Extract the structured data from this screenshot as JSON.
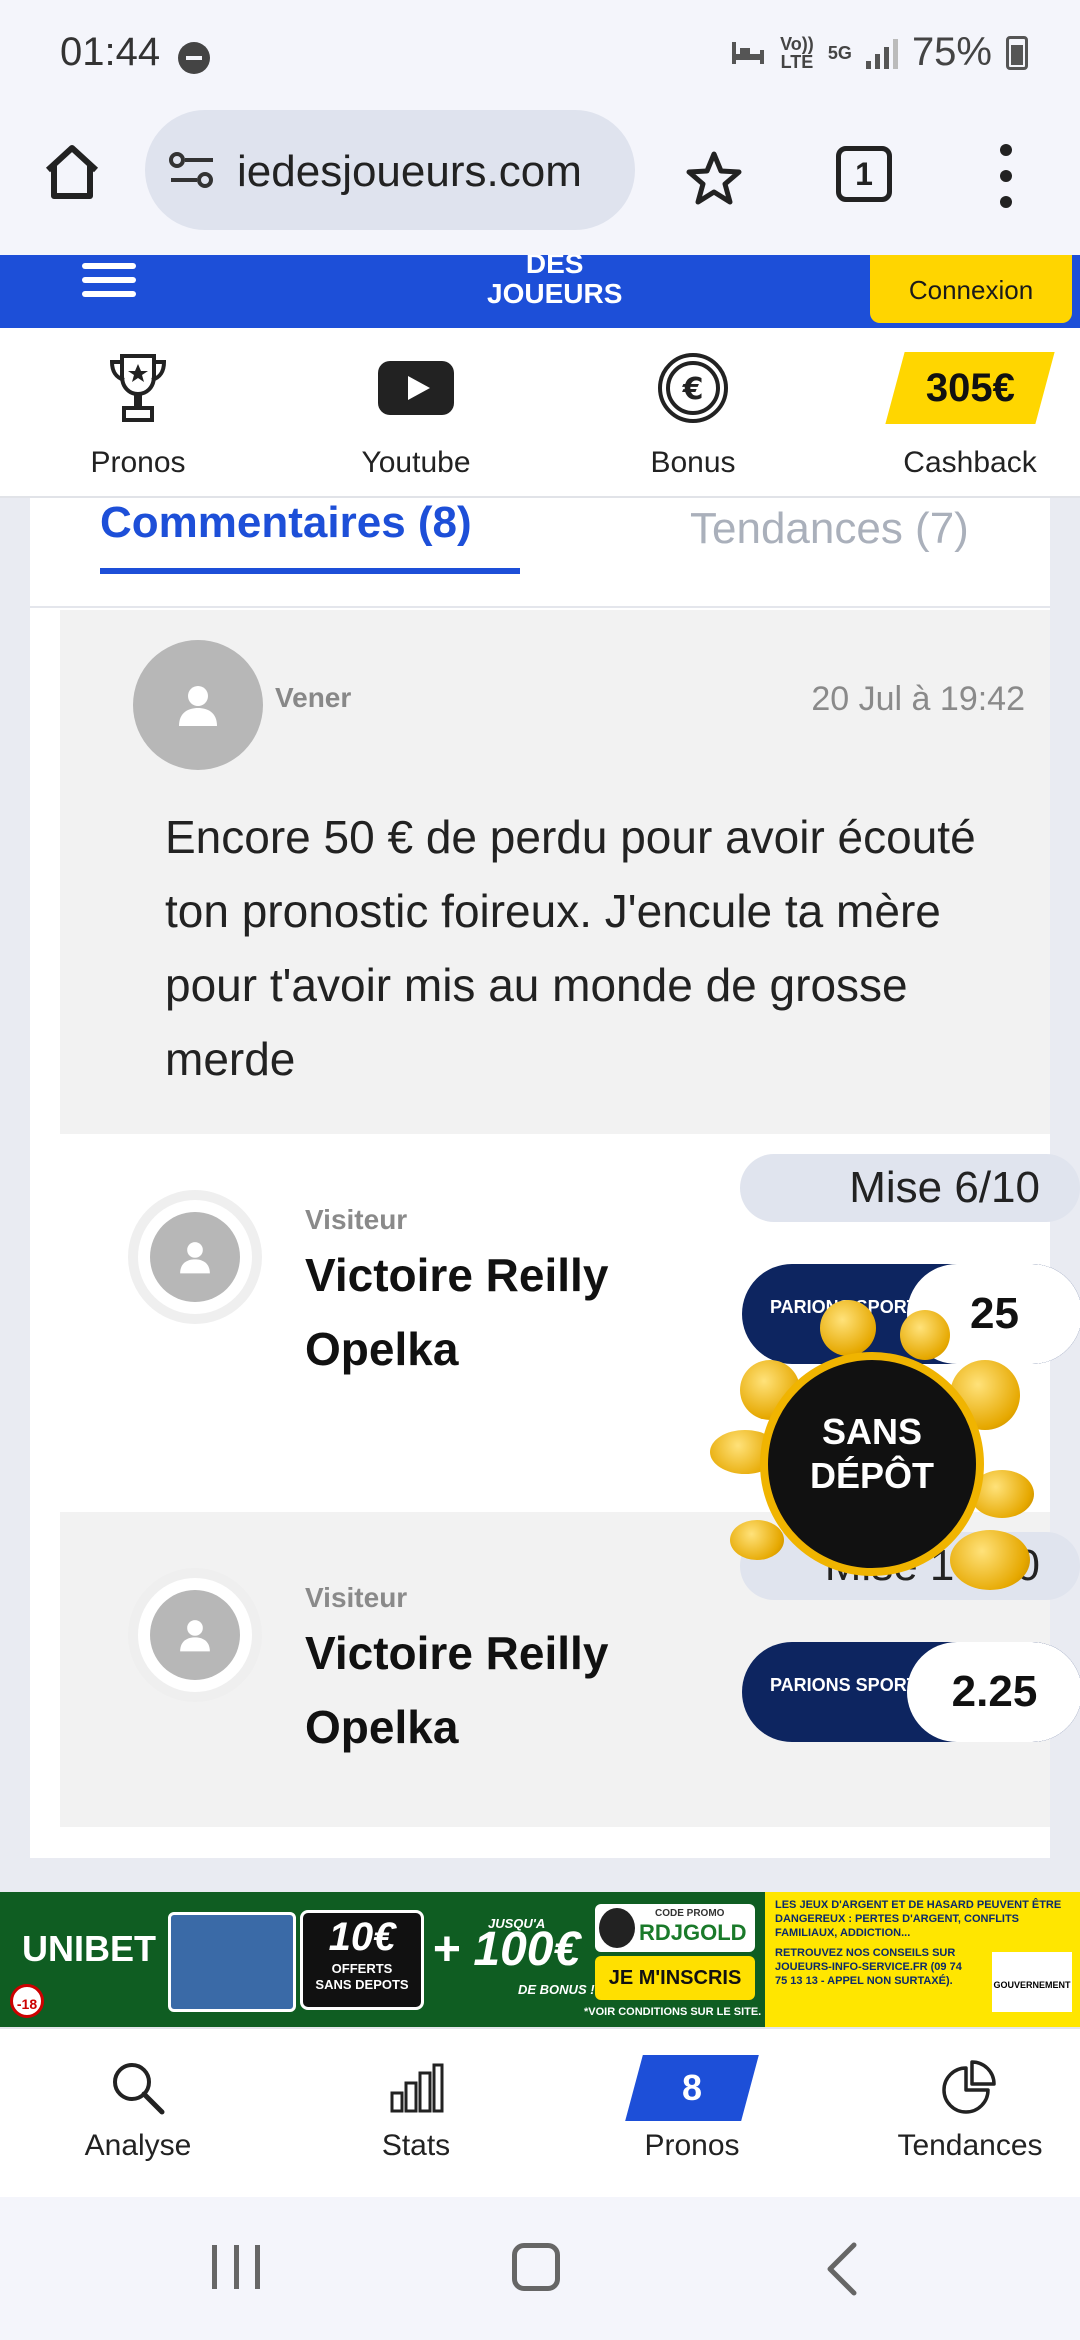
{
  "status_bar": {
    "time": "01:44",
    "volte": "Vo)) LTE",
    "network": "5G",
    "battery": "75%"
  },
  "browser": {
    "url": "iedesjoueurs.com",
    "tab_count": "1"
  },
  "site_header": {
    "logo_line1": "DES",
    "logo_line2": "JOUEURS",
    "login_label": "Connexion",
    "brand_color": "#1d4fd8",
    "accent_color": "#ffd500"
  },
  "quick_menu": {
    "pronos": "Pronos",
    "youtube": "Youtube",
    "bonus": "Bonus",
    "cashback_amount": "305€",
    "cashback": "Cashback"
  },
  "tabs": {
    "active": "Commentaires (8)",
    "inactive": "Tendances (7)"
  },
  "comment": {
    "author": "Vener",
    "date": "20 Jul à 19:42",
    "text": "Encore 50 € de perdu pour avoir écouté ton pronostic foireux. J'encule ta mère pour t'avoir mis au monde de grosse merde"
  },
  "pronos": [
    {
      "role": "Visiteur",
      "name": "Victoire Reilly Opelka",
      "stake": "Mise 6/10",
      "bookmaker": "PARIONS SPORT",
      "odds": "25"
    },
    {
      "role": "Visiteur",
      "name": "Victoire Reilly Opelka",
      "stake": "Mise 10/10",
      "bookmaker": "PARIONS SPORT",
      "odds": "2.25"
    }
  ],
  "promo_badge": {
    "line1": "SANS",
    "line2": "DÉPÔT"
  },
  "ad": {
    "brand": "UNIBET",
    "age": "-18",
    "offer_big": "10€",
    "offer_small1": "OFFERTS",
    "offer_small2": "SANS DEPOTS",
    "plus_up": "JUSQU'A",
    "plus_main": "+ 100€",
    "plus_down": "DE BONUS !*",
    "code_label": "CODE PROMO",
    "code_value": "RDJGOLD",
    "cta": "JE M'INSCRIS",
    "conditions": "*VOIR CONDITIONS SUR LE SITE.",
    "warning1": "LES JEUX D'ARGENT ET DE HASARD PEUVENT ÊTRE DANGEREUX : PERTES D'ARGENT, CONFLITS FAMILIAUX, ADDICTION...",
    "warning2": "RETROUVEZ NOS CONSEILS SUR JOUEURS-INFO-SERVICE.FR (09 74 75 13 13 - APPEL NON SURTAXÉ).",
    "gov": "GOUVERNEMENT"
  },
  "bottom_nav": {
    "analyse": "Analyse",
    "stats": "Stats",
    "pronos_count": "8",
    "pronos": "Pronos",
    "tendances": "Tendances"
  }
}
